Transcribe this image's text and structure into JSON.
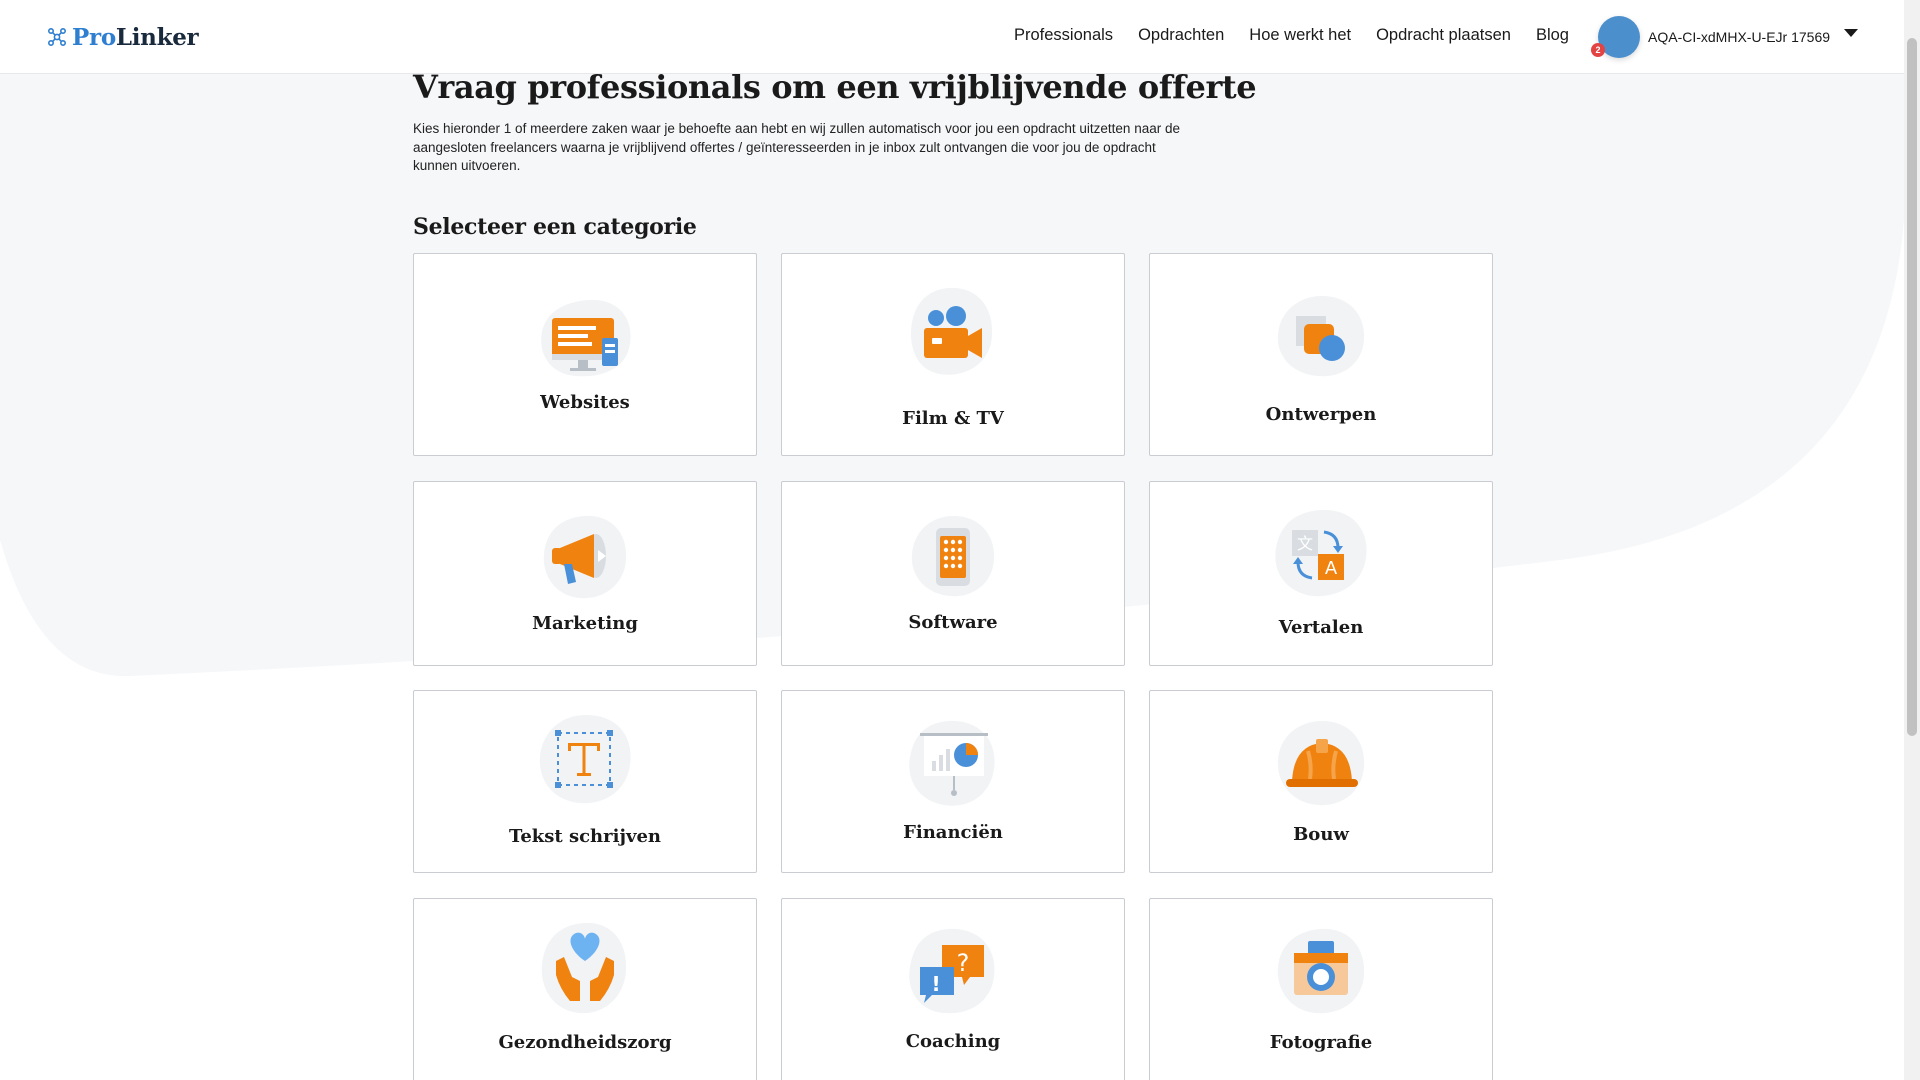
{
  "header": {
    "logo_pro": "Pro",
    "logo_linker": "Linker",
    "nav": [
      "Professionals",
      "Opdrachten",
      "Hoe werkt het",
      "Opdracht plaatsen",
      "Blog"
    ],
    "user": {
      "name": "AQA-CI-xdMHX-U-EJr 17569",
      "notification_count": "2"
    }
  },
  "main": {
    "title": "Vraag professionals om een vrijblijvende offerte",
    "intro": "Kies hieronder 1 of meerdere zaken waar je behoefte aan hebt en wij zullen automatisch voor jou een opdracht uitzetten naar de aangesloten freelancers waarna je vrijblijvend offertes / geïnteresseerden in je inbox zult ontvangen die voor jou de opdracht kunnen uitvoeren.",
    "section_title": "Selecteer een categorie",
    "categories": [
      {
        "label": "Websites",
        "icon": "monitor-icon"
      },
      {
        "label": "Film & TV",
        "icon": "video-camera-icon"
      },
      {
        "label": "Ontwerpen",
        "icon": "shapes-icon"
      },
      {
        "label": "Marketing",
        "icon": "megaphone-icon"
      },
      {
        "label": "Software",
        "icon": "phone-keypad-icon"
      },
      {
        "label": "Vertalen",
        "icon": "translate-icon"
      },
      {
        "label": "Tekst schrijven",
        "icon": "text-frame-icon"
      },
      {
        "label": "Financiën",
        "icon": "presentation-chart-icon"
      },
      {
        "label": "Bouw",
        "icon": "hard-hat-icon"
      },
      {
        "label": "Gezondheidszorg",
        "icon": "hands-heart-icon"
      },
      {
        "label": "Coaching",
        "icon": "speech-bubbles-icon"
      },
      {
        "label": "Fotografie",
        "icon": "camera-icon"
      }
    ]
  },
  "colors": {
    "brand_blue": "#2f7fd1",
    "icon_orange": "#f0820f",
    "icon_blue": "#4a90d9",
    "icon_bg": "#f1f3f5"
  }
}
